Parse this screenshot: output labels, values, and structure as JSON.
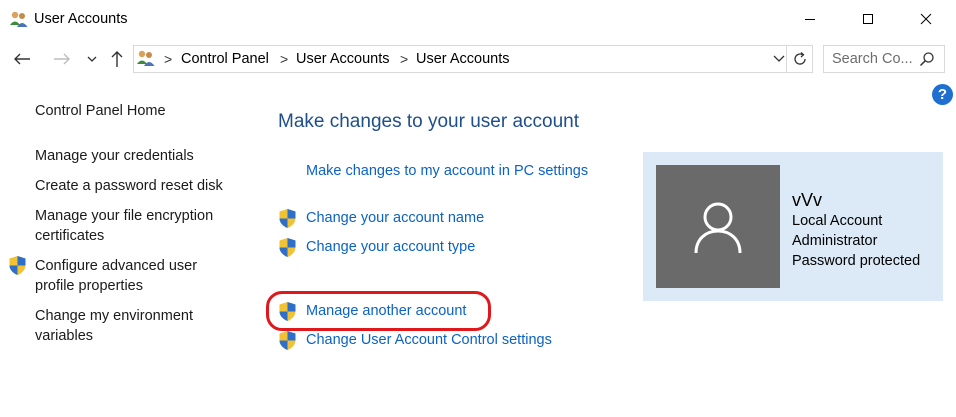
{
  "window": {
    "title": "User Accounts",
    "minimize_label": "Minimize",
    "maximize_label": "Maximize",
    "close_label": "Close"
  },
  "address_bar": {
    "breadcrumbs": [
      "Control Panel",
      "User Accounts",
      "User Accounts"
    ],
    "separator": ">"
  },
  "search": {
    "placeholder": "Search Co..."
  },
  "help": {
    "label": "?"
  },
  "left_pane": {
    "home": "Control Panel Home",
    "items": [
      {
        "label_lines": [
          "Manage your credentials"
        ],
        "shield": false
      },
      {
        "label_lines": [
          "Create a password reset disk"
        ],
        "shield": false
      },
      {
        "label_lines": [
          "Manage your file encryption",
          "certificates"
        ],
        "shield": false
      },
      {
        "label_lines": [
          "Configure advanced user",
          "profile properties"
        ],
        "shield": true
      },
      {
        "label_lines": [
          "Change my environment",
          "variables"
        ],
        "shield": false
      }
    ]
  },
  "main": {
    "heading": "Make changes to your user account",
    "pc_settings_link": "Make changes to my account in PC settings",
    "links": [
      "Change your account name",
      "Change your account type",
      "Manage another account",
      "Change User Account Control settings"
    ]
  },
  "account": {
    "name": "vVv",
    "type": "Local Account",
    "role": "Administrator",
    "protection": "Password protected"
  },
  "colors": {
    "link": "#0b62c4",
    "heading": "#1e4e8c",
    "card_bg": "#dbeaf6",
    "avatar_bg": "#6a6a6a",
    "highlight": "#e0181b"
  }
}
